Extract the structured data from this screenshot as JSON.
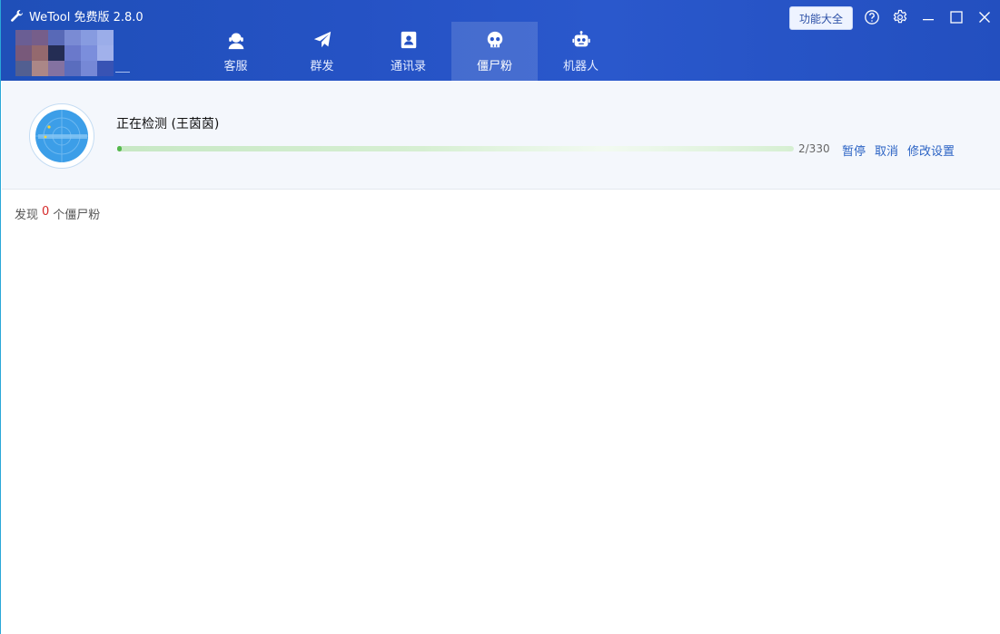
{
  "app": {
    "title": "WeTool 免费版 2.8.0"
  },
  "header": {
    "features_button": "功能大全",
    "tabs": [
      {
        "label": "客服",
        "icon": "headset-icon"
      },
      {
        "label": "群发",
        "icon": "paper-plane-icon"
      },
      {
        "label": "通讯录",
        "icon": "contact-book-icon"
      },
      {
        "label": "僵尸粉",
        "icon": "skull-icon",
        "active": true
      },
      {
        "label": "机器人",
        "icon": "robot-icon"
      }
    ]
  },
  "detection": {
    "status": "正在检测 (王茵茵)",
    "progress_text": "2/330",
    "progress_current": 2,
    "progress_total": 330,
    "pause": "暂停",
    "cancel": "取消",
    "settings": "修改设置"
  },
  "result": {
    "prefix": "发现",
    "count": "0",
    "suffix": "个僵尸粉"
  },
  "colors": {
    "header": "#2552c4",
    "accent": "#2b63c4",
    "progress": "#54b84c",
    "count": "#d62b2b"
  }
}
